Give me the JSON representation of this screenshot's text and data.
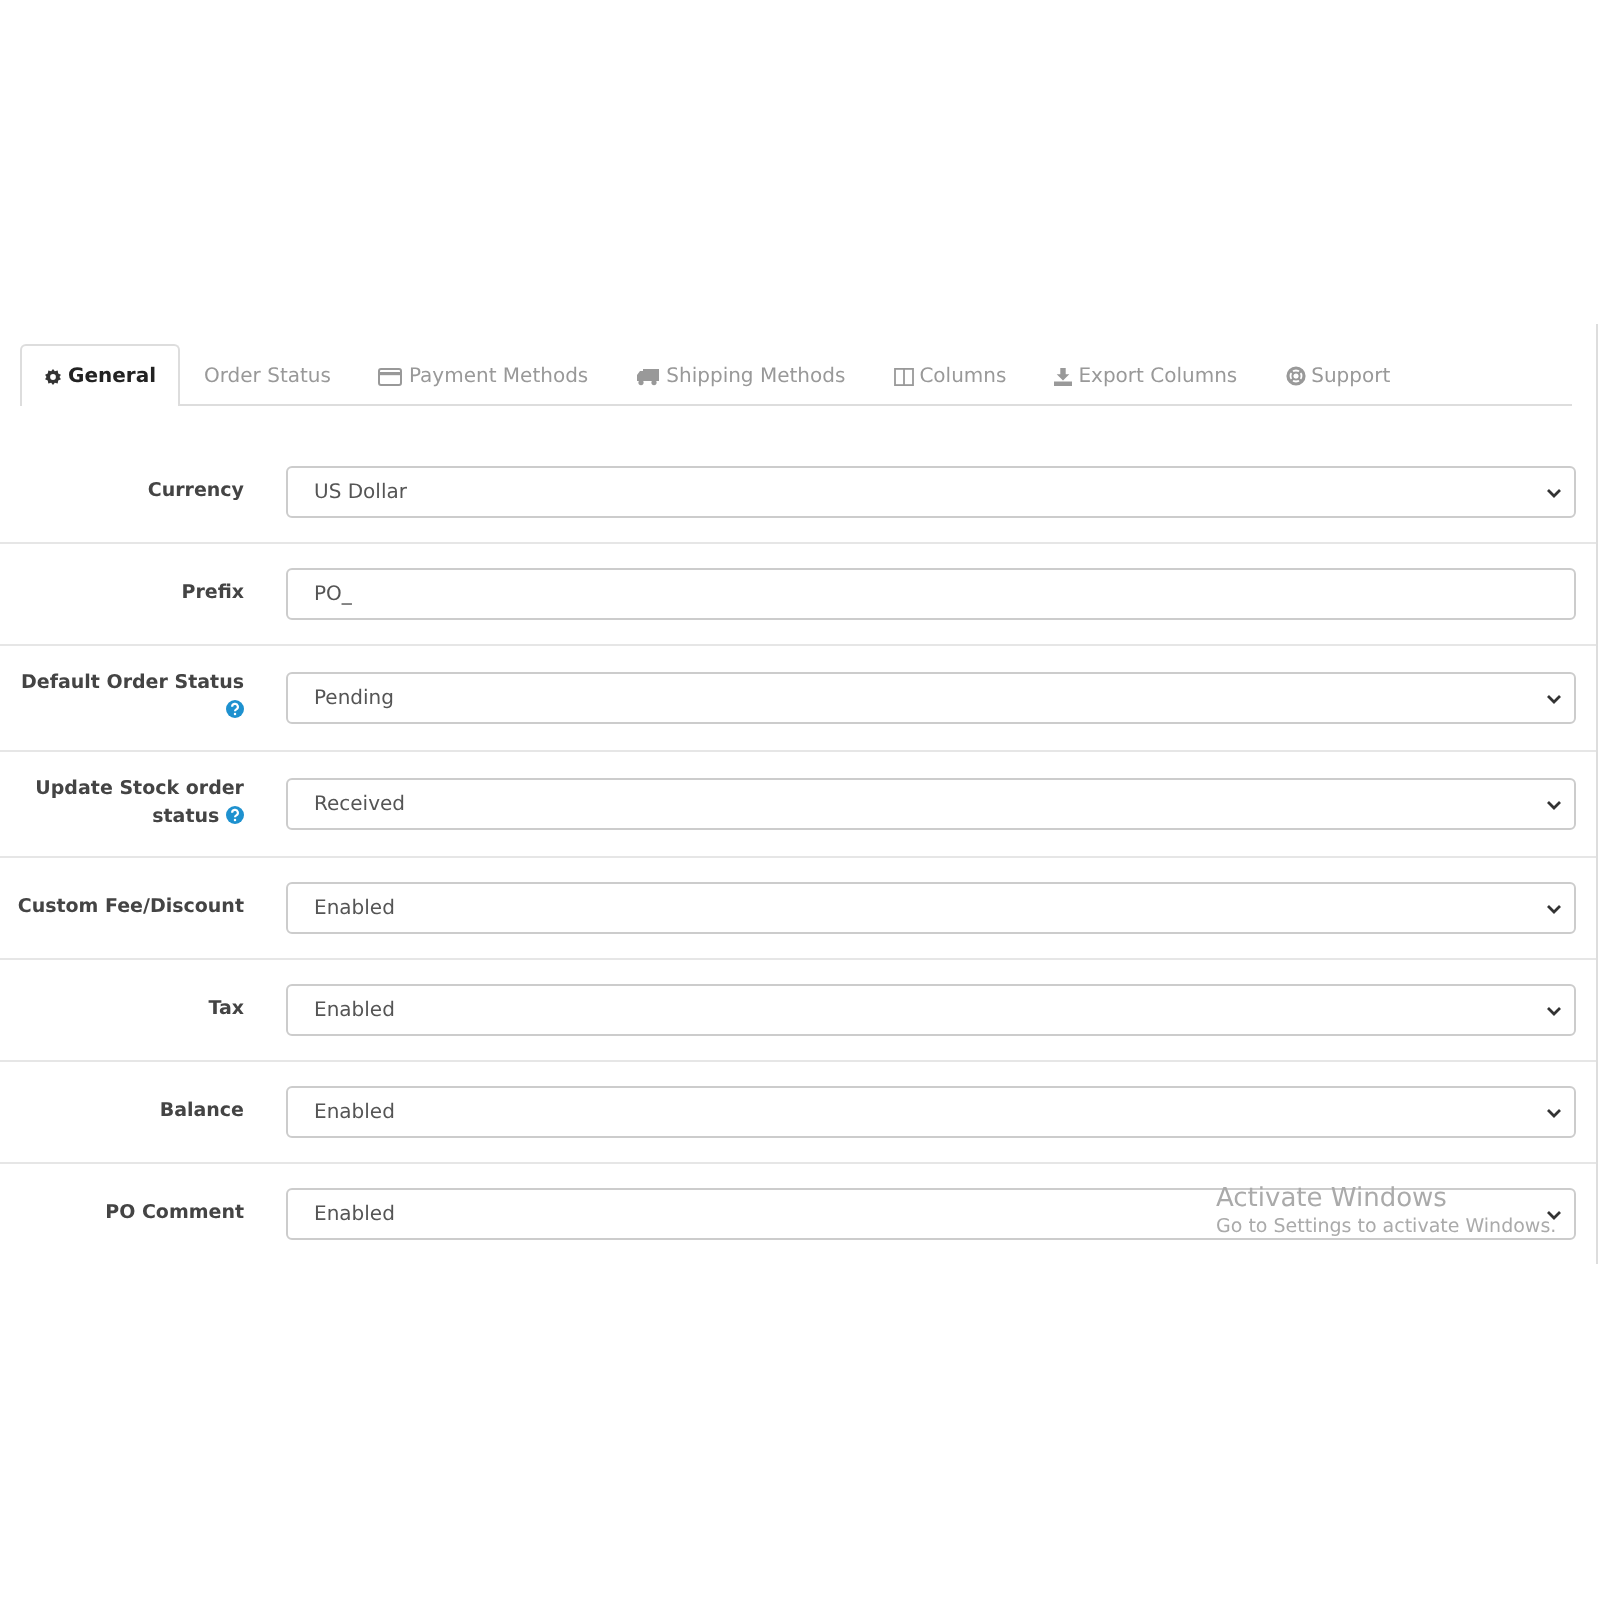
{
  "tabs": [
    {
      "label": "General",
      "selected": true
    },
    {
      "label": "Order Status",
      "selected": false
    },
    {
      "label": "Payment Methods",
      "selected": false
    },
    {
      "label": "Shipping Methods",
      "selected": false
    },
    {
      "label": "Columns",
      "selected": false
    },
    {
      "label": "Export Columns",
      "selected": false
    },
    {
      "label": "Support",
      "selected": false
    }
  ],
  "fields": [
    {
      "label": "Currency",
      "kind": "select",
      "value": "US Dollar",
      "help": false
    },
    {
      "label": "Prefix",
      "kind": "text",
      "value": "PO_",
      "help": false
    },
    {
      "label": "Default Order Status",
      "kind": "select",
      "value": "Pending",
      "help": true
    },
    {
      "label": "Update Stock order status",
      "kind": "select",
      "value": "Received",
      "help": true
    },
    {
      "label": "Custom Fee/Discount",
      "kind": "select",
      "value": "Enabled",
      "help": false
    },
    {
      "label": "Tax",
      "kind": "select",
      "value": "Enabled",
      "help": false
    },
    {
      "label": "Balance",
      "kind": "select",
      "value": "Enabled",
      "help": false
    },
    {
      "label": "PO Comment",
      "kind": "select",
      "value": "Enabled",
      "help": false
    }
  ],
  "os_overlay": {
    "title": "Activate Windows",
    "subtitle": "Go to Settings to activate Windows."
  }
}
